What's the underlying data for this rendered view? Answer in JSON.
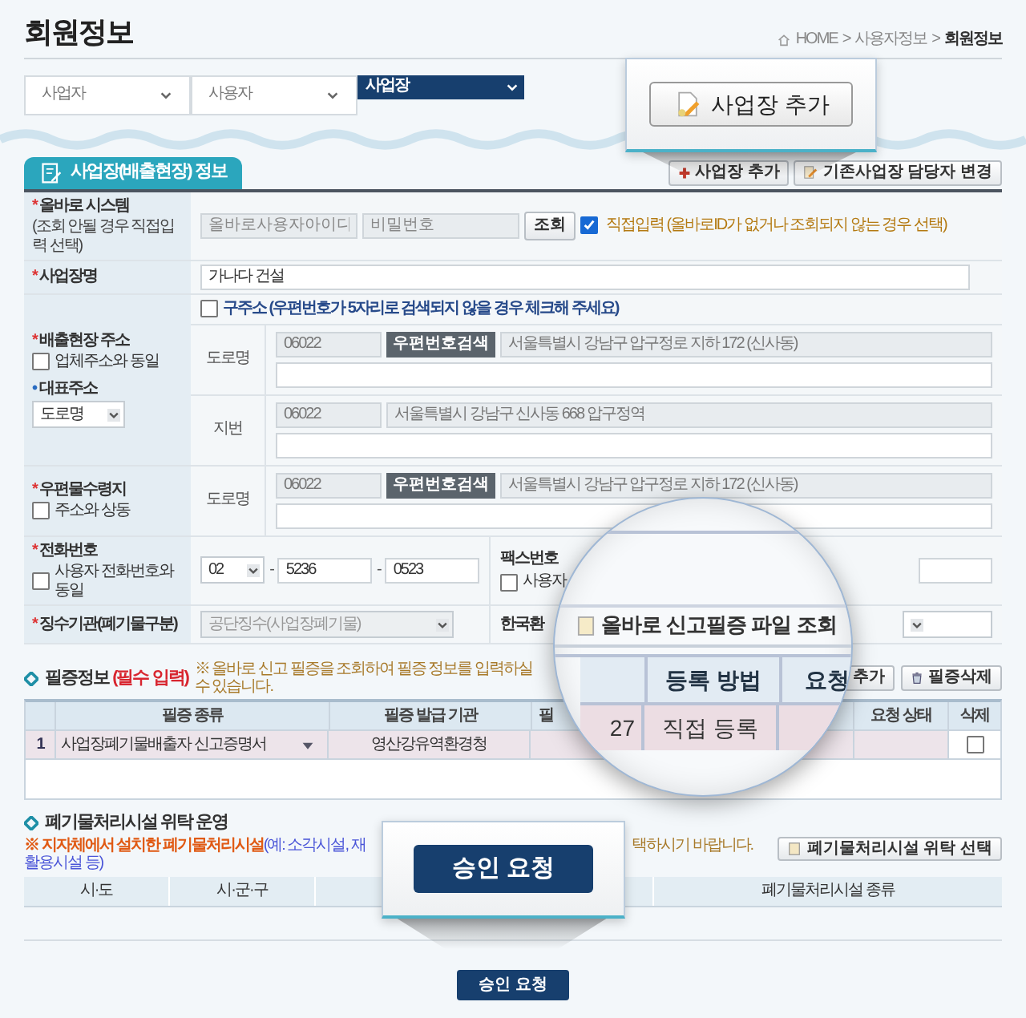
{
  "page_title": "회원정보",
  "breadcrumb": {
    "separator": ">",
    "items": [
      "HOME",
      "사용자정보",
      "회원정보"
    ]
  },
  "tabs": [
    {
      "label": "사업자",
      "selected": false
    },
    {
      "label": "사용자",
      "selected": false
    },
    {
      "label": "사업장",
      "selected": true
    }
  ],
  "callout_add": {
    "button": "사업장 추가"
  },
  "section": {
    "title": "사업장(배출현장) 정보",
    "buttons": [
      {
        "label": "사업장 추가",
        "kind": "plus"
      },
      {
        "label": "기존사업장 담당자 변경",
        "kind": "edit"
      }
    ]
  },
  "form": {
    "allbaro": {
      "mark": "*",
      "label": "올바로 시스템",
      "note": "(조회 안될 경우 직접입력 선택)",
      "id_placeholder": "올바로사용자아이디",
      "password_placeholder": "비밀번호",
      "lookup_button": "조회",
      "direct_input": {
        "checked": true,
        "label": "직접입력 (올바로ID가 없거나 조회되지 않는 경우 선택)"
      }
    },
    "site_name": {
      "mark": "*",
      "label": "사업장명",
      "value": "가나다 건설"
    },
    "site_address": {
      "mark": "*",
      "label": "배출현장 주소",
      "same_as_company": {
        "checked": false,
        "label": "업체주소와 동일"
      },
      "primary_mark": "•",
      "primary_label": "대표주소",
      "primary_select": "도로명",
      "old_address": {
        "checked": false,
        "label": "구주소 (우편번호가 5자리로 검색되지 않을 경우 체크해 주세요)"
      },
      "lines": [
        {
          "label": "도로명",
          "zip": "06022",
          "search_button": "우편번호검색",
          "address": "서울특별시 강남구 압구정로 지하 172 (신사동)"
        },
        {
          "label": "지번",
          "zip": "06022",
          "address": "서울특별시 강남구 신사동 668 압구정역"
        }
      ]
    },
    "mailing_address": {
      "mark": "*",
      "label": "우편물수령지",
      "same_as_address": {
        "checked": false,
        "label": "주소와 상동"
      },
      "lines": [
        {
          "label": "도로명",
          "zip": "06022",
          "search_button": "우편번호검색",
          "address": "서울특별시 강남구 압구정로 지하 172 (신사동)"
        }
      ]
    },
    "phone": {
      "mark": "*",
      "label": "전화번호",
      "same_as_user": {
        "checked": false,
        "label": "사용자 전화번호와 동일"
      },
      "area": "02",
      "separator": "-",
      "middle": "5236",
      "last": "0523"
    },
    "fax": {
      "label": "팩스번호",
      "same_as_user": {
        "checked": false,
        "label": "사용자"
      }
    },
    "collector": {
      "mark": "*",
      "label": "징수기관(폐기물구분)",
      "value": "공단징수(사업장폐기물)",
      "disabled": true
    },
    "agency": {
      "label": "한국환"
    }
  },
  "certificates": {
    "title": "필증정보",
    "required": "(필수 입력)",
    "notice": "※ 올바로 신고 필증을 조회하여 필증 정보를 입력하실 수 있습니다.",
    "buttons": [
      {
        "label": "추가",
        "kind": "plain"
      },
      {
        "label": "필증삭제",
        "kind": "trash"
      }
    ],
    "columns": [
      "필증 종류",
      "필증 발급 기관",
      "필",
      "요청 상태",
      "삭제"
    ],
    "rows": [
      {
        "number": "1",
        "type": "사업장폐기물배출자 신고증명서",
        "issuer": "영산강유역환경청",
        "delete_checked": false
      }
    ]
  },
  "magnifier": {
    "button": "올바로 신고필증 파일 조회",
    "columns": [
      "등록 방법",
      "요청"
    ],
    "row": [
      "27",
      "직접 등록"
    ]
  },
  "facility": {
    "title": "폐기물처리시설 위탁 운영",
    "notice_lead": "※ 지자체에서 설치한 폐기물처리시설",
    "notice_example": "(예: 소각시설, 재활용시설 등)",
    "notice_tail": "택하시기 바랍니다.",
    "button": "폐기물처리시설 위탁 선택",
    "columns": [
      "시·도",
      "시·군·구",
      "폐기물처리시설 종류"
    ]
  },
  "callout_submit": {
    "button": "승인 요청"
  },
  "submit_button": "승인 요청"
}
